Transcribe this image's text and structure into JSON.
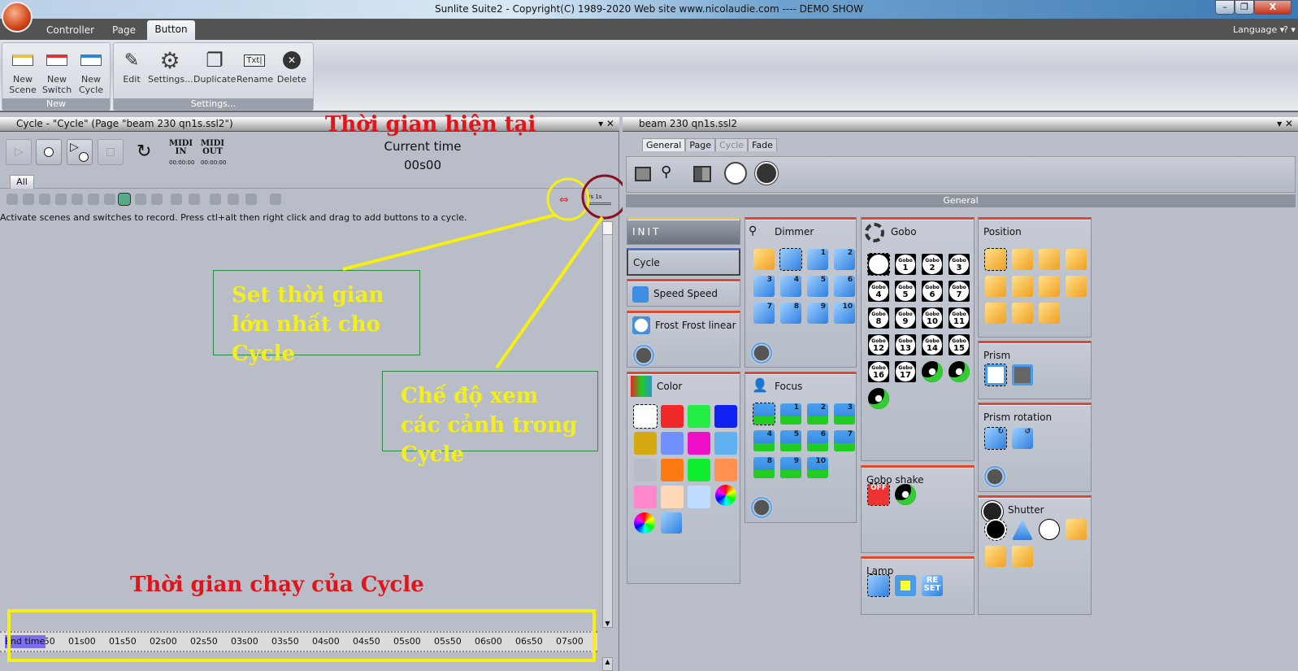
{
  "window": {
    "title": "Sunlite Suite2 - Copyright(C) 1989-2020    Web site www.nicolaudie.com ---- DEMO SHOW",
    "min": "–",
    "max": "❐",
    "close": "X"
  },
  "ribbon": {
    "tabs": [
      "Controller",
      "Page",
      "Button"
    ],
    "active_tab": "Button",
    "language": "Language ▾",
    "help": "? ▾",
    "groups": [
      {
        "label": "New",
        "buttons": [
          "New\nScene",
          "New\nSwitch",
          "New\nCycle"
        ]
      },
      {
        "label": "Settings...",
        "buttons": [
          "Edit",
          "Settings...",
          "Duplicate",
          "Rename",
          "Delete"
        ]
      }
    ]
  },
  "cycle_panel": {
    "title": "Cycle - \"Cycle\" (Page \"beam 230 qn1s.ssl2\")",
    "midi_in": "MIDI\nIN",
    "midi_out": "MIDI\nOUT",
    "midi_in_time": "00:00:00",
    "midi_out_time": "00:00:00",
    "current_time_label": "Current time",
    "current_time": "00s00",
    "tab": "All",
    "info": "Activate scenes and switches to record. Press ctl+alt then right click and drag to add buttons to a cycle.",
    "end_time_label": "End time",
    "timeline_labels": [
      "00s50",
      "01s00",
      "01s50",
      "02s00",
      "02s50",
      "03s00",
      "03s50",
      "04s00",
      "04s50",
      "05s00",
      "05s50",
      "06s00",
      "06s50",
      "07s00"
    ]
  },
  "annotations": {
    "current_time": "Thời gian hiện tại",
    "set_max": "Set thời gian lớn nhất cho Cycle",
    "view_mode": "Chế độ xem các cảnh trong Cycle",
    "run_time": "Thời gian chạy của Cycle",
    "highlight_yellow": "#f7ef12",
    "highlight_darkred": "#8a1020"
  },
  "page_panel": {
    "title": "beam 230 qn1s.ssl2",
    "tabs": [
      "General",
      "Page",
      "Cycle",
      "Fade"
    ],
    "active_tab": "General",
    "disabled_tab": "Cycle",
    "section": "General",
    "groups": {
      "init": "INIT",
      "cycle": "Cycle",
      "speed": "Speed Speed",
      "frost": "Frost Frost linear",
      "color": "Color",
      "dimmer": "Dimmer",
      "focus": "Focus",
      "gobo": "Gobo",
      "gobo_shake": "Gobo shake",
      "lamp": "Lamp",
      "position": "Position",
      "prism": "Prism",
      "prism_rotation": "Prism rotation",
      "shutter": "Shutter"
    },
    "colors": [
      "#ffffff",
      "#f02828",
      "#22ee44",
      "#1020f0",
      "#d4aa10",
      "#7090ff",
      "#ee10c8",
      "#60b0f0",
      "#b8bcc6",
      "#ff7a10",
      "#10ee30",
      "#ff9050",
      "#ff88cc",
      "#ffd8b8",
      "#c0ddff"
    ],
    "dimmer_labels": [
      "",
      "",
      "1",
      "2",
      "3",
      "4",
      "5",
      "6",
      "7",
      "8",
      "9",
      "10"
    ],
    "focus_labels": [
      "",
      "1",
      "2",
      "3",
      "4",
      "5",
      "6",
      "7",
      "8",
      "9",
      "10"
    ],
    "gobo_labels": [
      "",
      "1",
      "2",
      "3",
      "4",
      "5",
      "6",
      "7",
      "8",
      "9",
      "10",
      "11",
      "12",
      "13",
      "14",
      "15",
      "16",
      "17"
    ],
    "gobo_word": "Gobo",
    "lamp_reset": "RE SET",
    "shake_off": "OFF"
  }
}
